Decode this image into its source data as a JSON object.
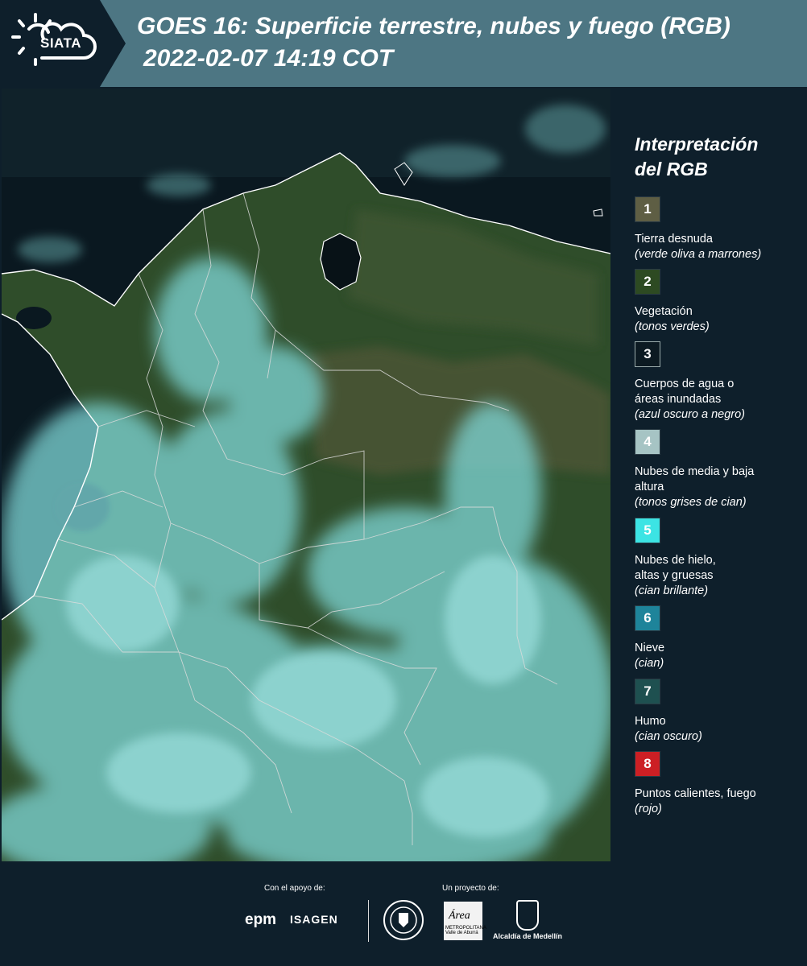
{
  "header": {
    "logo_text": "SIATA",
    "title_line1": "GOES 16: Superficie terrestre, nubes y fuego (RGB)",
    "title_line2": "2022-02-07 14:19 COT"
  },
  "legend": {
    "title_line1": "Interpretación",
    "title_line2": "del RGB",
    "items": [
      {
        "num": "1",
        "color": "#5e5e44",
        "text_color": "#ffffff",
        "name": "Tierra desnuda",
        "sub": "(verde oliva a marrones)"
      },
      {
        "num": "2",
        "color": "#2d4a22",
        "text_color": "#ffffff",
        "name": "Vegetación",
        "sub": "(tonos verdes)"
      },
      {
        "num": "3",
        "color": "#0c1a22",
        "text_color": "#ffffff",
        "name": "Cuerpos de agua o áreas inundadas",
        "sub": "(azul oscuro a negro)"
      },
      {
        "num": "4",
        "color": "#a6c4c4",
        "text_color": "#ffffff",
        "name": "Nubes de media y baja altura",
        "sub": "(tonos grises de cian)"
      },
      {
        "num": "5",
        "color": "#3ce4e4",
        "text_color": "#ffffff",
        "name": "Nubes de hielo, altas y gruesas",
        "sub": "(cian brillante)"
      },
      {
        "num": "6",
        "color": "#1e849a",
        "text_color": "#ffffff",
        "name": "Nieve",
        "sub": "(cian)"
      },
      {
        "num": "7",
        "color": "#1e5050",
        "text_color": "#ffffff",
        "name": "Humo",
        "sub": "(cian oscuro)"
      },
      {
        "num": "8",
        "color": "#cc1f24",
        "text_color": "#ffffff",
        "name": "Puntos calientes, fuego",
        "sub": "(rojo)"
      }
    ]
  },
  "footer": {
    "support_label": "Con el apoyo de:",
    "project_label": "Un proyecto de:",
    "epm_logo_text": "epm",
    "isagen_logo_text": "ISAGEN",
    "area_metro_word": "Área",
    "area_metro_sub": "METROPOLITANA Valle de Aburrá",
    "medellin_label": "Alcaldía de Medellín"
  },
  "colors": {
    "background": "#0e1f2b",
    "header_bar": "#4d7683",
    "ocean": "#0b1a22",
    "vegetation": "#2d4a22",
    "cloud_cyan": "#7fd8d8"
  }
}
